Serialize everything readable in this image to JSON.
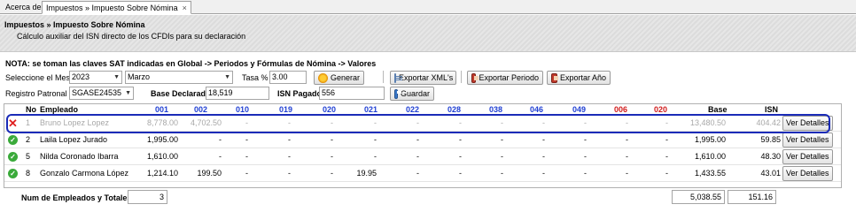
{
  "tabs": [
    {
      "label": "Acerca de"
    },
    {
      "label": "Impuestos » Impuesto Sobre Nómina",
      "close": "×"
    }
  ],
  "header": {
    "title": "Impuestos » Impuesto Sobre Nómina",
    "subtitle": "Cálculo auxiliar del ISN directo de los CFDIs para su declaración"
  },
  "note": "NOTA: se toman las claves SAT indicadas en Global -> Periodos y Fórmulas de Nómina -> Valores",
  "form": {
    "mes_label": "Seleccione el Mes",
    "year": "2023",
    "month": "Marzo",
    "tasa_label": "Tasa %",
    "tasa": "3.00",
    "generar": "Generar",
    "export_xml": "Exportar XML's",
    "export_periodo": "Exportar Periodo",
    "export_anio": "Exportar Año",
    "registro_label": "Registro Patronal",
    "registro": "SGASE24535",
    "base_label": "Base Declarada",
    "base": "18,519",
    "isn_label": "ISN Pagado",
    "isn": "556",
    "guardar": "Guardar"
  },
  "grid": {
    "headers": {
      "no": "No",
      "empleado": "Empleado",
      "codes": [
        "001",
        "002",
        "010",
        "019",
        "020",
        "021",
        "022",
        "028",
        "038",
        "046",
        "049",
        "006",
        "020"
      ],
      "base": "Base",
      "isn": "ISN"
    },
    "rows": [
      {
        "status": "error",
        "status_glyph": "✕",
        "no": "1",
        "name": "Bruno Lopez Lopez",
        "vals": [
          "8,778.00",
          "4,702.50",
          "-",
          "-",
          "-",
          "-",
          "-",
          "-",
          "-",
          "-",
          "-",
          "-",
          "-"
        ],
        "base": "13,480.50",
        "isn": "404.42",
        "btn": "Ver Detalles"
      },
      {
        "status": "ok",
        "status_glyph": "✓",
        "no": "2",
        "name": "Laila Lopez Jurado",
        "vals": [
          "1,995.00",
          "-",
          "-",
          "-",
          "-",
          "-",
          "-",
          "-",
          "-",
          "-",
          "-",
          "-",
          "-"
        ],
        "base": "1,995.00",
        "isn": "59.85",
        "btn": "Ver Detalles"
      },
      {
        "status": "ok",
        "status_glyph": "✓",
        "no": "5",
        "name": "Nilda Coronado Ibarra",
        "vals": [
          "1,610.00",
          "-",
          "-",
          "-",
          "-",
          "-",
          "-",
          "-",
          "-",
          "-",
          "-",
          "-",
          "-"
        ],
        "base": "1,610.00",
        "isn": "48.30",
        "btn": "Ver Detalles"
      },
      {
        "status": "ok",
        "status_glyph": "✓",
        "no": "8",
        "name": "Gonzalo Carmona López",
        "vals": [
          "1,214.10",
          "199.50",
          "-",
          "-",
          "-",
          "19.95",
          "-",
          "-",
          "-",
          "-",
          "-",
          "-",
          "-"
        ],
        "base": "1,433.55",
        "isn": "43.01",
        "btn": "Ver Detalles"
      }
    ]
  },
  "footer": {
    "label": "Num de Empleados y Totales",
    "count": "3",
    "total_base": "5,038.55",
    "total_isn": "151.16"
  }
}
